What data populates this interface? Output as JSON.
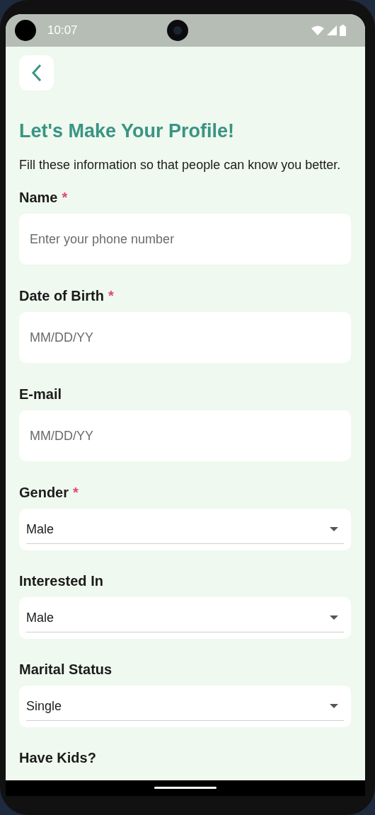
{
  "status_bar": {
    "time": "10:07"
  },
  "title": "Let's Make Your Profile!",
  "subtitle": "Fill these information so that people can know you better.",
  "fields": [
    {
      "kind": "text",
      "label": "Name",
      "required_mark": "*",
      "placeholder": "Enter your phone number"
    },
    {
      "kind": "text",
      "label": "Date of Birth",
      "required_mark": "*",
      "placeholder": "MM/DD/YY"
    },
    {
      "kind": "text",
      "label": "E-mail",
      "placeholder": "MM/DD/YY"
    },
    {
      "kind": "dropdown",
      "label": "Gender",
      "required_mark": "*",
      "value": "Male"
    },
    {
      "kind": "dropdown",
      "label": "Interested In",
      "value": "Male"
    },
    {
      "kind": "dropdown",
      "label": "Marital Status",
      "value": "Single"
    },
    {
      "kind": "heading",
      "label": "Have Kids?"
    }
  ]
}
